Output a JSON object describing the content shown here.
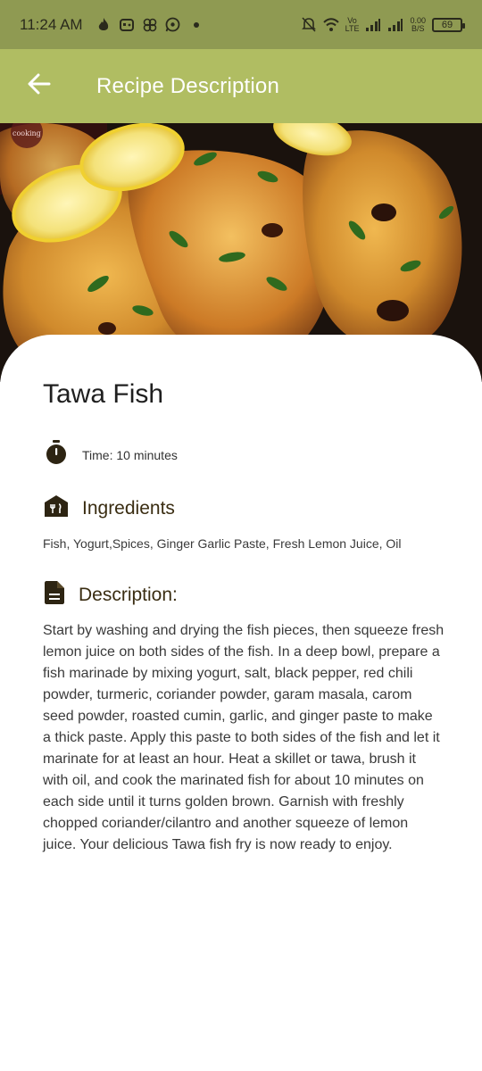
{
  "status_bar": {
    "time": "11:24 AM",
    "net_speed_value": "0.00",
    "net_speed_unit": "B/S",
    "battery": "69",
    "volte": "Vo",
    "lte": "LTE",
    "icons": [
      "fire-icon",
      "gamepad-icon",
      "pinwheel-icon",
      "whatsapp-icon",
      "dot-icon",
      "mute-bell-icon",
      "wifi-icon",
      "signal-icon",
      "signal-icon",
      "battery-icon"
    ]
  },
  "app_bar": {
    "title": "Recipe Description",
    "back_icon": "arrow-left-icon",
    "color": "#b0bd62"
  },
  "hero": {
    "watermark": "cooking"
  },
  "recipe": {
    "title": "Tawa Fish",
    "time": "Time: 10 minutes",
    "ingredients_heading": "Ingredients",
    "ingredients": "Fish, Yogurt,Spices, Ginger Garlic Paste, Fresh Lemon Juice, Oil",
    "description_heading": "Description:",
    "description": "Start by washing and drying the fish pieces, then squeeze fresh lemon juice on both sides of the fish. In a deep bowl, prepare a fish marinade by mixing yogurt, salt, black pepper, red chili powder, turmeric, coriander powder, garam masala, carom seed powder, roasted cumin, garlic, and ginger paste to make a thick paste. Apply this paste to both sides of the fish and let it marinate for at least an hour. Heat a skillet or tawa, brush it with oil, and cook the marinated fish for about 10 minutes on each side until it turns golden brown. Garnish with freshly chopped coriander/cilantro and another squeeze of lemon juice. Your delicious Tawa fish fry is now ready to enjoy."
  },
  "colors": {
    "status_bar": "#8f9a52",
    "app_bar": "#b0bd62",
    "heading": "#3a2d12",
    "icon": "#2d2412"
  }
}
